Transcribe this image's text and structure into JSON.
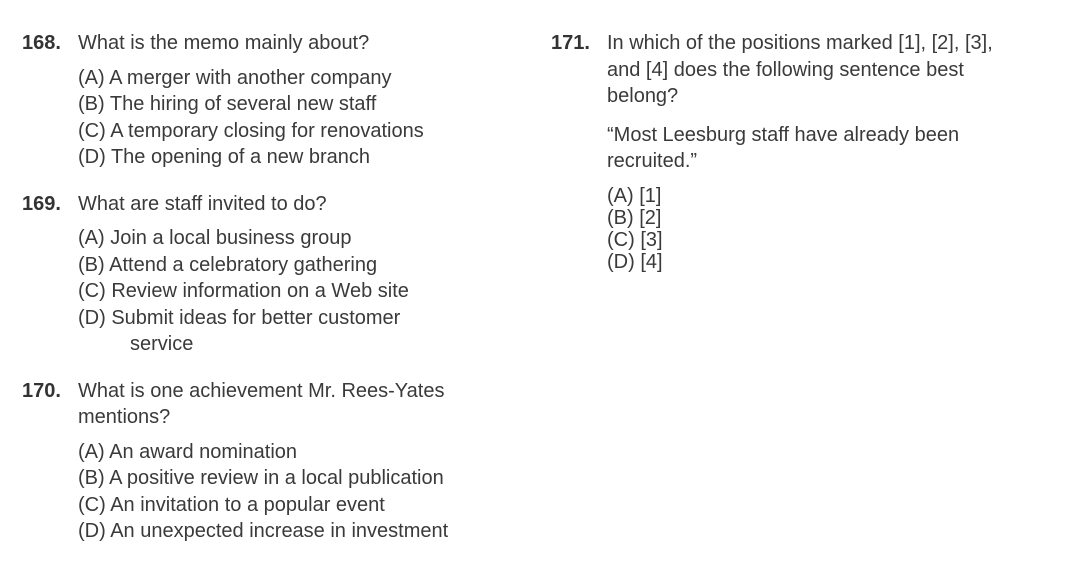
{
  "left": {
    "questions": [
      {
        "number": "168.",
        "text": "What is the memo mainly about?",
        "options": [
          "(A) A merger with another company",
          "(B) The hiring of several new staff",
          "(C) A temporary closing for renovations",
          "(D) The opening of a new branch"
        ]
      },
      {
        "number": "169.",
        "text": "What are staff invited to do?",
        "options": [
          "(A) Join a local business group",
          "(B) Attend a celebratory gathering",
          "(C) Review information on a Web site",
          "(D) Submit ideas for better customer"
        ],
        "option_d_continuation": "service"
      },
      {
        "number": "170.",
        "text_line1": "What is one achievement Mr. Rees-Yates",
        "text_line2": "mentions?",
        "options": [
          "(A) An award nomination",
          "(B) A positive review in a local publication",
          "(C) An invitation to a popular event",
          "(D) An unexpected increase in investment"
        ]
      }
    ]
  },
  "right": {
    "number": "171.",
    "text_line1": "In which of the positions marked [1], [2], [3],",
    "text_line2": "and [4] does the following sentence best",
    "text_line3": "belong?",
    "quote_line1": "“Most Leesburg staff have already been",
    "quote_line2": "recruited.”",
    "options": [
      "(A) [1]",
      "(B) [2]",
      "(C) [3]",
      "(D) [4]"
    ]
  }
}
